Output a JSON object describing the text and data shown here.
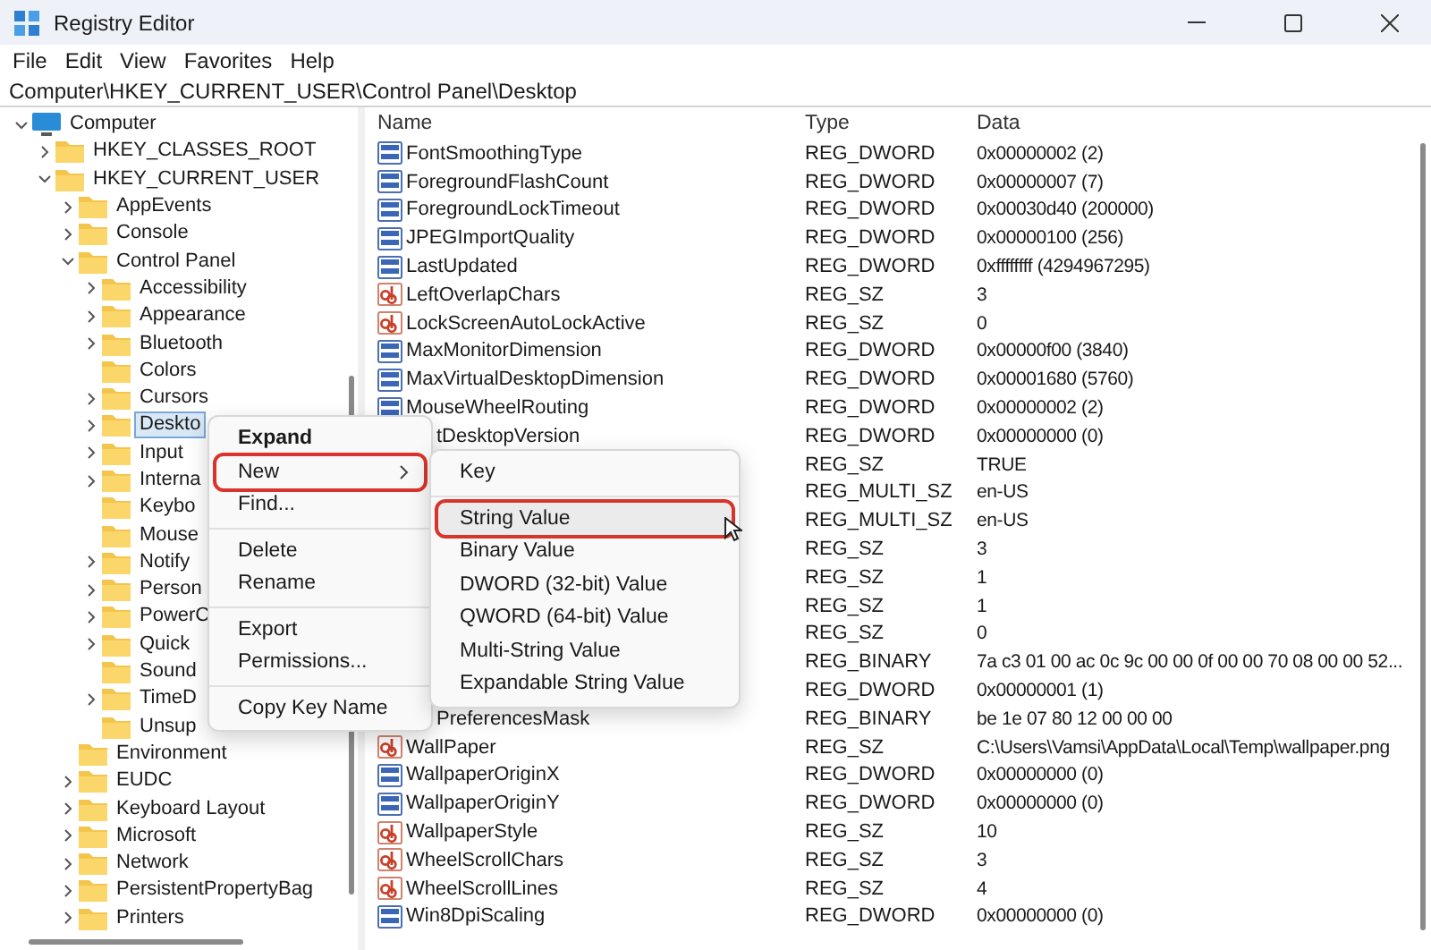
{
  "window": {
    "title": "Registry Editor"
  },
  "menu_bar": [
    "File",
    "Edit",
    "View",
    "Favorites",
    "Help"
  ],
  "address": "Computer\\HKEY_CURRENT_USER\\Control Panel\\Desktop",
  "tree": [
    {
      "label": "Computer",
      "kind": "computer",
      "expanded": true,
      "selected": false,
      "children": [
        {
          "label": "HKEY_CLASSES_ROOT",
          "expanded": false,
          "selected": false
        },
        {
          "label": "HKEY_CURRENT_USER",
          "expanded": true,
          "selected": false,
          "children": [
            {
              "label": "AppEvents",
              "expanded": false,
              "selected": false
            },
            {
              "label": "Console",
              "expanded": false,
              "selected": false
            },
            {
              "label": "Control Panel",
              "expanded": true,
              "selected": false,
              "children": [
                {
                  "label": "Accessibility",
                  "expanded": false,
                  "selected": false
                },
                {
                  "label": "Appearance",
                  "expanded": false,
                  "selected": false
                },
                {
                  "label": "Bluetooth",
                  "expanded": false,
                  "selected": false
                },
                {
                  "label": "Colors",
                  "selected": false
                },
                {
                  "label": "Cursors",
                  "expanded": false,
                  "selected": false
                },
                {
                  "label": "Deskto",
                  "expanded": false,
                  "selected": true
                },
                {
                  "label": "Input",
                  "expanded": false,
                  "selected": false
                },
                {
                  "label": "Interna",
                  "expanded": false,
                  "selected": false
                },
                {
                  "label": "Keybo",
                  "selected": false
                },
                {
                  "label": "Mouse",
                  "selected": false
                },
                {
                  "label": "Notify",
                  "expanded": false,
                  "selected": false
                },
                {
                  "label": "Person",
                  "expanded": false,
                  "selected": false
                },
                {
                  "label": "PowerC",
                  "expanded": false,
                  "selected": false
                },
                {
                  "label": "Quick",
                  "expanded": false,
                  "selected": false
                },
                {
                  "label": "Sound",
                  "selected": false
                },
                {
                  "label": "TimeD",
                  "expanded": false,
                  "selected": false
                },
                {
                  "label": "Unsup",
                  "selected": false
                }
              ]
            },
            {
              "label": "Environment",
              "selected": false
            },
            {
              "label": "EUDC",
              "expanded": false,
              "selected": false
            },
            {
              "label": "Keyboard Layout",
              "expanded": false,
              "selected": false
            },
            {
              "label": "Microsoft",
              "expanded": false,
              "selected": false
            },
            {
              "label": "Network",
              "expanded": false,
              "selected": false
            },
            {
              "label": "PersistentPropertyBag",
              "expanded": false,
              "selected": false
            },
            {
              "label": "Printers",
              "expanded": false,
              "selected": false
            }
          ]
        }
      ]
    }
  ],
  "table": {
    "columns": [
      "Name",
      "Type",
      "Data"
    ],
    "rows": [
      {
        "name": "FontSmoothingType",
        "kind": "binary",
        "type": "REG_DWORD",
        "data": "0x00000002 (2)"
      },
      {
        "name": "ForegroundFlashCount",
        "kind": "binary",
        "type": "REG_DWORD",
        "data": "0x00000007 (7)"
      },
      {
        "name": "ForegroundLockTimeout",
        "kind": "binary",
        "type": "REG_DWORD",
        "data": "0x00030d40 (200000)"
      },
      {
        "name": "JPEGImportQuality",
        "kind": "binary",
        "type": "REG_DWORD",
        "data": "0x00000100 (256)"
      },
      {
        "name": "LastUpdated",
        "kind": "binary",
        "type": "REG_DWORD",
        "data": "0xffffffff (4294967295)"
      },
      {
        "name": "LeftOverlapChars",
        "kind": "string",
        "type": "REG_SZ",
        "data": "3"
      },
      {
        "name": "LockScreenAutoLockActive",
        "kind": "string",
        "type": "REG_SZ",
        "data": "0"
      },
      {
        "name": "MaxMonitorDimension",
        "kind": "binary",
        "type": "REG_DWORD",
        "data": "0x00000f00 (3840)"
      },
      {
        "name": "MaxVirtualDesktopDimension",
        "kind": "binary",
        "type": "REG_DWORD",
        "data": "0x00001680 (5760)"
      },
      {
        "name": "MouseWheelRouting",
        "kind": "binary",
        "type": "REG_DWORD",
        "data": "0x00000002 (2)"
      },
      {
        "name": "tDesktopVersion",
        "cut": true,
        "type": "REG_DWORD",
        "data": "0x00000000 (0)"
      },
      {
        "type": "REG_SZ",
        "data": "TRUE"
      },
      {
        "type": "REG_MULTI_SZ",
        "data": "en-US"
      },
      {
        "type": "REG_MULTI_SZ",
        "data": "en-US"
      },
      {
        "type": "REG_SZ",
        "data": "3"
      },
      {
        "type": "REG_SZ",
        "data": "1"
      },
      {
        "type": "REG_SZ",
        "data": "1"
      },
      {
        "type": "REG_SZ",
        "data": "0"
      },
      {
        "type": "REG_BINARY",
        "data": "7a c3 01 00 ac 0c 9c 00 00 0f 00 00 70 08 00 00 52..."
      },
      {
        "type": "REG_DWORD",
        "data": "0x00000001 (1)"
      },
      {
        "name": "PreferencesMask",
        "cut": true,
        "type": "REG_BINARY",
        "data": "be 1e 07 80 12 00 00 00"
      },
      {
        "name": "WallPaper",
        "kind": "string",
        "type": "REG_SZ",
        "data": "C:\\Users\\Vamsi\\AppData\\Local\\Temp\\wallpaper.png"
      },
      {
        "name": "WallpaperOriginX",
        "kind": "binary",
        "type": "REG_DWORD",
        "data": "0x00000000 (0)"
      },
      {
        "name": "WallpaperOriginY",
        "kind": "binary",
        "type": "REG_DWORD",
        "data": "0x00000000 (0)"
      },
      {
        "name": "WallpaperStyle",
        "kind": "string",
        "type": "REG_SZ",
        "data": "10"
      },
      {
        "name": "WheelScrollChars",
        "kind": "string",
        "type": "REG_SZ",
        "data": "3"
      },
      {
        "name": "WheelScrollLines",
        "kind": "string",
        "type": "REG_SZ",
        "data": "4"
      },
      {
        "name": "Win8DpiScaling",
        "kind": "binary",
        "type": "REG_DWORD",
        "data": "0x00000000 (0)"
      }
    ]
  },
  "context_menu": {
    "groups": [
      [
        {
          "label": "Expand",
          "bold": true,
          "submenu": false,
          "highlighted": false
        },
        {
          "label": "New",
          "bold": false,
          "submenu": true,
          "highlighted": true
        },
        {
          "label": "Find...",
          "bold": false,
          "submenu": false,
          "highlighted": false
        }
      ],
      [
        {
          "label": "Delete",
          "bold": false,
          "submenu": false,
          "highlighted": false
        },
        {
          "label": "Rename",
          "bold": false,
          "submenu": false,
          "highlighted": false
        }
      ],
      [
        {
          "label": "Export",
          "bold": false,
          "submenu": false,
          "highlighted": false
        },
        {
          "label": "Permissions...",
          "bold": false,
          "submenu": false,
          "highlighted": false
        }
      ],
      [
        {
          "label": "Copy Key Name",
          "bold": false,
          "submenu": false,
          "highlighted": false
        }
      ]
    ]
  },
  "submenu": {
    "groups": [
      [
        {
          "label": "Key",
          "highlighted": false,
          "hovered": false
        }
      ],
      [
        {
          "label": "String Value",
          "highlighted": true,
          "hovered": true
        },
        {
          "label": "Binary Value",
          "highlighted": false,
          "hovered": false
        },
        {
          "label": "DWORD (32-bit) Value",
          "highlighted": false,
          "hovered": false
        },
        {
          "label": "QWORD (64-bit) Value",
          "highlighted": false,
          "hovered": false
        },
        {
          "label": "Multi-String Value",
          "highlighted": false,
          "hovered": false
        },
        {
          "label": "Expandable String Value",
          "highlighted": false,
          "hovered": false
        }
      ]
    ]
  }
}
